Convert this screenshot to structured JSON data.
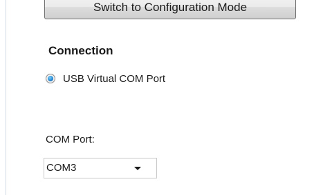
{
  "toolbar": {
    "mode_button_label": "Switch to Configuration Mode"
  },
  "connection": {
    "title": "Connection",
    "options": [
      {
        "label": "USB Virtual COM Port",
        "selected": true
      }
    ]
  },
  "com_port": {
    "label": "COM Port:",
    "selected_value": "COM3",
    "icon": "chevron-down-icon"
  },
  "colors": {
    "radio_selected": "#2a8ad4",
    "panel_border": "#cfd8e4"
  }
}
